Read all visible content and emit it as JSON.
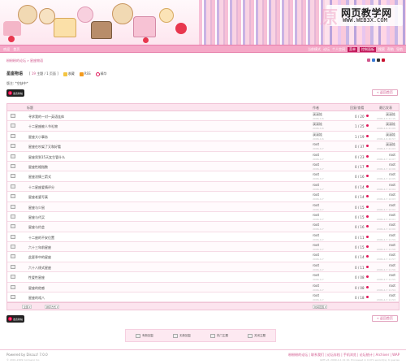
{
  "watermark": {
    "main": "网页教学网",
    "url": "WWW.WEB3X.COM",
    "ghost": "原"
  },
  "topnav": {
    "left": [
      "欢迎",
      "首页"
    ],
    "right": [
      "当前模式",
      "论坛",
      "个人空间",
      "菜单",
      "控制面板",
      "搜索",
      "帮助",
      "导航"
    ]
  },
  "breadcrumb": "粉粉粉的论坛 » 星座物语",
  "style_colors": [
    "#d0568c",
    "#3a7bd5",
    "#333333",
    "#c8102e"
  ],
  "forum": {
    "title": "星座物语",
    "topics_num": "19",
    "topics_label": "主题",
    "pages_label": "/ 1 页面",
    "fav": "收藏",
    "rss": "RSS",
    "post": "精华",
    "moderators": "版主: *空缺中*"
  },
  "buttons": {
    "newtopic": "发表新帖",
    "back": "« 返回首页"
  },
  "table": {
    "headers": {
      "title": "标题",
      "author": "作者",
      "stats": "回复/查看",
      "last": "最后发表"
    },
    "rows": [
      {
        "title": "寻求我的一对一英语连体",
        "author": "溪溪娃",
        "date": "2006-4-6",
        "stats": "0 / 20",
        "last": "溪溪娃",
        "ldate": "2006-4-6 21:15"
      },
      {
        "title": "十二星座被人节礼物",
        "author": "溪溪娃",
        "date": "2006-4-6",
        "stats": "1 / 25",
        "last": "溪溪娃",
        "ldate": "2006-4-6 21:09"
      },
      {
        "title": "星座大小事务",
        "author": "溪溪娃",
        "date": "2006-4-6",
        "stats": "1 / 19",
        "last": "溪溪娃",
        "ldate": "2006-4-6 20:57"
      },
      {
        "title": "星座在吵架了又和好看",
        "author": "root",
        "date": "2006-4-7",
        "stats": "0 / 37",
        "last": "溪溪娃",
        "ldate": "2006-4-7 21:03"
      },
      {
        "title": "星座男到15天女生管什么",
        "author": "root",
        "date": "2006-4-7",
        "stats": "0 / 23",
        "last": "root",
        "ldate": "2006-4-7 12:07"
      },
      {
        "title": "星座性格指数",
        "author": "root",
        "date": "2006-4-7",
        "stats": "0 / 17",
        "last": "root",
        "ldate": "2006-4-7 12:06"
      },
      {
        "title": "星座浓情三箭式",
        "author": "root",
        "date": "2006-4-7",
        "stats": "0 / 16",
        "last": "root",
        "ldate": "2006-4-7 12:05"
      },
      {
        "title": "十二星座爱情评分",
        "author": "root",
        "date": "2006-4-7",
        "stats": "0 / 14",
        "last": "root",
        "ldate": "2006-4-7 12:04"
      },
      {
        "title": "星座老婆写真",
        "author": "root",
        "date": "2006-4-7",
        "stats": "0 / 14",
        "last": "root",
        "ldate": "2006-4-7 12:03"
      },
      {
        "title": "星座与少鼠",
        "author": "root",
        "date": "2006-4-7",
        "stats": "0 / 15",
        "last": "root",
        "ldate": "2006-4-7 12:02"
      },
      {
        "title": "星座与代买",
        "author": "root",
        "date": "2006-4-7",
        "stats": "0 / 15",
        "last": "root",
        "ldate": "2006-4-7 12:01"
      },
      {
        "title": "星座与约会",
        "author": "root",
        "date": "2006-4-7",
        "stats": "0 / 16",
        "last": "root",
        "ldate": "2006-4-7 12:00"
      },
      {
        "title": "十二座的不安位置",
        "author": "root",
        "date": "2006-4-7",
        "stats": "0 / 11",
        "last": "root",
        "ldate": "2006-4-7 11:59"
      },
      {
        "title": "六十三年前星座",
        "author": "root",
        "date": "2006-4-7",
        "stats": "0 / 15",
        "last": "root",
        "ldate": "2006-4-7 11:58"
      },
      {
        "title": "此夏季中的星座",
        "author": "root",
        "date": "2006-4-7",
        "stats": "0 / 14",
        "last": "root",
        "ldate": "2006-4-7 11:57"
      },
      {
        "title": "六十八线式星座",
        "author": "root",
        "date": "2006-4-7",
        "stats": "0 / 11",
        "last": "root",
        "ldate": "2006-4-7 11:56"
      },
      {
        "title": "性爱性星座",
        "author": "root",
        "date": "2006-4-7",
        "stats": "0 / 08",
        "last": "root",
        "ldate": "2006-4-7 11:55"
      },
      {
        "title": "星座的他感",
        "author": "root",
        "date": "2006-4-7",
        "stats": "0 / 08",
        "last": "root",
        "ldate": "2006-4-7 11:54"
      },
      {
        "title": "星座的戏八",
        "author": "root",
        "date": "2006-4-7",
        "stats": "0 / 18",
        "last": "root",
        "ldate": "2006-4-7 11:53"
      }
    ]
  },
  "tfoot": {
    "sel1": "全部",
    "sel2": "排序方式",
    "sel3": "时间范围"
  },
  "legend": [
    "有新回复",
    "无新回复",
    "热门主题",
    "关闭主题"
  ],
  "footer": {
    "l1": "Powered by Discuz! 7.0.0",
    "l2": "© 2001-2009 Comsenz Inc.",
    "r1": "粉粉粉的论坛 | 联系我们 | 论坛存档 | 手机浏览 | 论坛统计 | Archiver | WAP",
    "r2": "GMT+8, 2009-4-1 21:10, Processed in 0.071 second(s), 6 queries"
  }
}
